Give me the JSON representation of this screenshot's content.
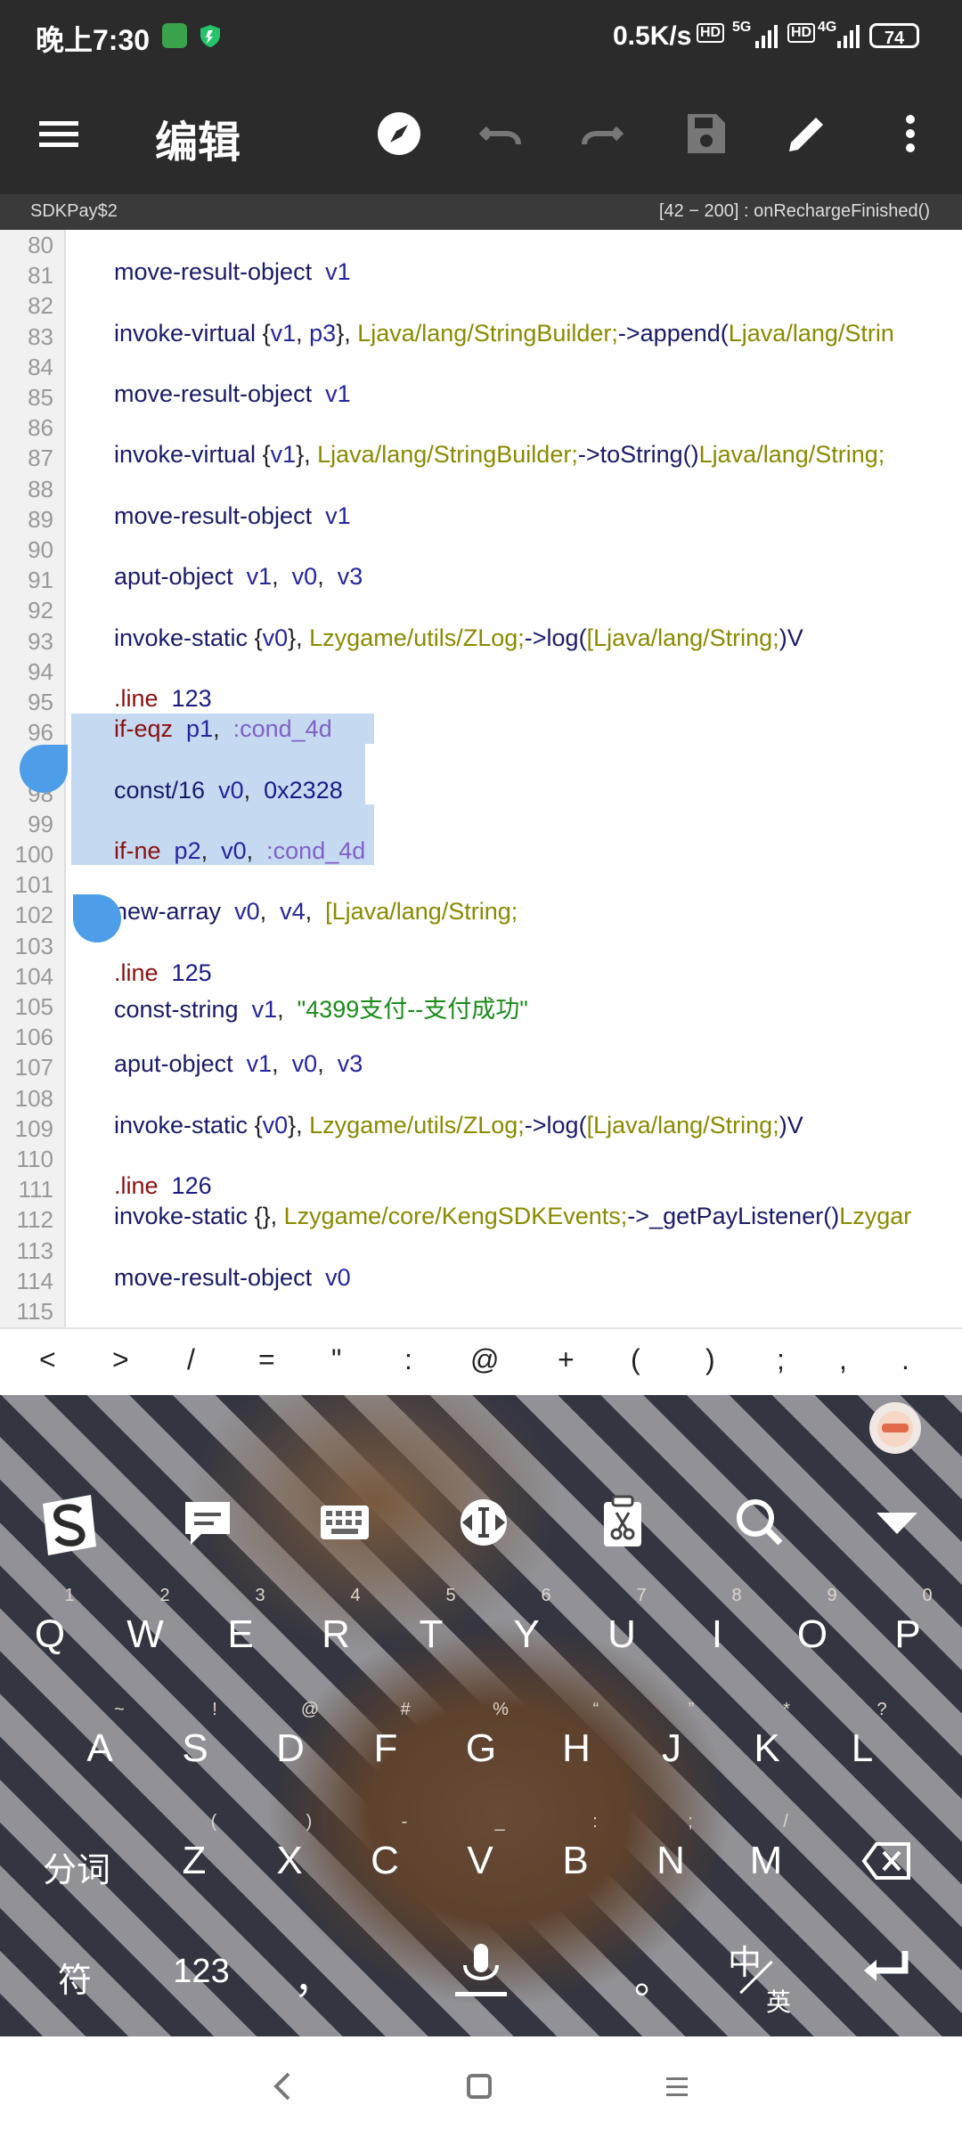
{
  "status_bar": {
    "time": "晚上7:30",
    "speed": "0.5K/s",
    "net1": "5G",
    "net2": "4G",
    "battery": "74"
  },
  "toolbar": {
    "title": "编辑",
    "icons": [
      "menu-icon",
      "compass-icon",
      "undo-icon",
      "redo-icon",
      "save-icon",
      "edit-icon",
      "more-icon"
    ]
  },
  "subbar": {
    "class_name": "SDKPay$2",
    "position": "[42 − 200] : onRechargeFinished()"
  },
  "editor": {
    "line_numbers": [
      "80",
      "81",
      "82",
      "83",
      "84",
      "85",
      "86",
      "87",
      "88",
      "89",
      "90",
      "91",
      "92",
      "93",
      "94",
      "95",
      "96",
      "97",
      "98",
      "99",
      "100",
      "101",
      "102",
      "103",
      "104",
      "105",
      "106",
      "107",
      "108",
      "109",
      "110",
      "111",
      "112",
      "113",
      "114",
      "115"
    ],
    "lines": [
      {
        "n": "81",
        "parts": [
          [
            "kw",
            "move-result-object"
          ],
          [
            "",
            "  "
          ],
          [
            "reg",
            "v1"
          ]
        ]
      },
      {
        "n": "83",
        "parts": [
          [
            "kw",
            "invoke-virtual"
          ],
          [
            "",
            " {"
          ],
          [
            "reg",
            "v1"
          ],
          [
            "",
            ", "
          ],
          [
            "reg",
            "p3"
          ],
          [
            "",
            "}, "
          ],
          [
            "typ",
            "Ljava/lang/StringBuilder;"
          ],
          [
            "kw",
            "->append("
          ],
          [
            "typ",
            "Ljava/lang/Strin"
          ]
        ]
      },
      {
        "n": "85",
        "parts": [
          [
            "kw",
            "move-result-object"
          ],
          [
            "",
            "  "
          ],
          [
            "reg",
            "v1"
          ]
        ]
      },
      {
        "n": "87",
        "parts": [
          [
            "kw",
            "invoke-virtual"
          ],
          [
            "",
            " {"
          ],
          [
            "reg",
            "v1"
          ],
          [
            "",
            "}, "
          ],
          [
            "typ",
            "Ljava/lang/StringBuilder;"
          ],
          [
            "kw",
            "->toString()"
          ],
          [
            "typ",
            "Ljava/lang/String;"
          ]
        ]
      },
      {
        "n": "89",
        "parts": [
          [
            "kw",
            "move-result-object"
          ],
          [
            "",
            "  "
          ],
          [
            "reg",
            "v1"
          ]
        ]
      },
      {
        "n": "91",
        "parts": [
          [
            "kw",
            "aput-object"
          ],
          [
            "",
            "  "
          ],
          [
            "reg",
            "v1"
          ],
          [
            "",
            ",  "
          ],
          [
            "reg",
            "v0"
          ],
          [
            "",
            ",  "
          ],
          [
            "reg",
            "v3"
          ]
        ]
      },
      {
        "n": "93",
        "parts": [
          [
            "kw",
            "invoke-static"
          ],
          [
            "",
            " {"
          ],
          [
            "reg",
            "v0"
          ],
          [
            "",
            "}, "
          ],
          [
            "typ",
            "Lzygame/utils/ZLog;"
          ],
          [
            "kw",
            "->log("
          ],
          [
            "typ",
            "[Ljava/lang/String;"
          ],
          [
            "kw",
            ")V"
          ]
        ]
      },
      {
        "n": "95",
        "parts": [
          [
            "op",
            ".line"
          ],
          [
            "",
            "  "
          ],
          [
            "num",
            "123"
          ]
        ]
      },
      {
        "n": "96",
        "parts": [
          [
            "op",
            "if-eqz"
          ],
          [
            "",
            "  "
          ],
          [
            "reg",
            "p1"
          ],
          [
            "",
            ",  "
          ],
          [
            "lbl",
            ":cond_4d"
          ]
        ]
      },
      {
        "n": "98",
        "parts": [
          [
            "kw",
            "const/16"
          ],
          [
            "",
            "  "
          ],
          [
            "reg",
            "v0"
          ],
          [
            "",
            ",  "
          ],
          [
            "num",
            "0x2328"
          ]
        ]
      },
      {
        "n": "100",
        "parts": [
          [
            "op",
            "if-ne"
          ],
          [
            "",
            "  "
          ],
          [
            "reg",
            "p2"
          ],
          [
            "",
            ",  "
          ],
          [
            "reg",
            "v0"
          ],
          [
            "",
            ",  "
          ],
          [
            "lbl",
            ":cond_4d"
          ]
        ]
      },
      {
        "n": "102",
        "parts": [
          [
            "kw",
            "new-array"
          ],
          [
            "",
            "  "
          ],
          [
            "reg",
            "v0"
          ],
          [
            "",
            ",  "
          ],
          [
            "reg",
            "v4"
          ],
          [
            "",
            ",  "
          ],
          [
            "typ",
            "[Ljava/lang/String;"
          ]
        ]
      },
      {
        "n": "104",
        "parts": [
          [
            "op",
            ".line"
          ],
          [
            "",
            "  "
          ],
          [
            "num",
            "125"
          ]
        ]
      },
      {
        "n": "105",
        "parts": [
          [
            "kw",
            "const-string"
          ],
          [
            "",
            "  "
          ],
          [
            "reg",
            "v1"
          ],
          [
            "",
            ",  "
          ],
          [
            "str",
            "\"4399支付--支付成功\""
          ]
        ]
      },
      {
        "n": "107",
        "parts": [
          [
            "kw",
            "aput-object"
          ],
          [
            "",
            "  "
          ],
          [
            "reg",
            "v1"
          ],
          [
            "",
            ",  "
          ],
          [
            "reg",
            "v0"
          ],
          [
            "",
            ",  "
          ],
          [
            "reg",
            "v3"
          ]
        ]
      },
      {
        "n": "109",
        "parts": [
          [
            "kw",
            "invoke-static"
          ],
          [
            "",
            " {"
          ],
          [
            "reg",
            "v0"
          ],
          [
            "",
            "}, "
          ],
          [
            "typ",
            "Lzygame/utils/ZLog;"
          ],
          [
            "kw",
            "->log("
          ],
          [
            "typ",
            "[Ljava/lang/String;"
          ],
          [
            "kw",
            ")V"
          ]
        ]
      },
      {
        "n": "111",
        "parts": [
          [
            "op",
            ".line"
          ],
          [
            "",
            "  "
          ],
          [
            "num",
            "126"
          ]
        ]
      },
      {
        "n": "112",
        "parts": [
          [
            "kw",
            "invoke-static"
          ],
          [
            "",
            " {}, "
          ],
          [
            "typ",
            "Lzygame/core/KengSDKEvents;"
          ],
          [
            "kw",
            "->_getPayListener()"
          ],
          [
            "typ",
            "Lzygar"
          ]
        ]
      },
      {
        "n": "114",
        "parts": [
          [
            "kw",
            "move-result-object"
          ],
          [
            "",
            "  "
          ],
          [
            "reg",
            "v0"
          ]
        ]
      }
    ]
  },
  "symbols": [
    "<",
    ">",
    "/",
    "=",
    "\"",
    ":",
    "@",
    "+",
    "(",
    ")",
    ";",
    ",",
    "."
  ],
  "keyboard": {
    "toolbar_icons": [
      "sogou-logo-icon",
      "chat-icon",
      "keyboard-icon",
      "cursor-icon",
      "clipboard-icon",
      "search-icon",
      "collapse-icon"
    ],
    "row1": [
      [
        "Q",
        "1"
      ],
      [
        "W",
        "2"
      ],
      [
        "E",
        "3"
      ],
      [
        "R",
        "4"
      ],
      [
        "T",
        "5"
      ],
      [
        "Y",
        "6"
      ],
      [
        "U",
        "7"
      ],
      [
        "I",
        "8"
      ],
      [
        "O",
        "9"
      ],
      [
        "P",
        "0"
      ]
    ],
    "row2": [
      [
        "A",
        "~"
      ],
      [
        "S",
        "!"
      ],
      [
        "D",
        "@"
      ],
      [
        "F",
        "#"
      ],
      [
        "G",
        "%"
      ],
      [
        "H",
        "“"
      ],
      [
        "J",
        "”"
      ],
      [
        "K",
        "*"
      ],
      [
        "L",
        "?"
      ]
    ],
    "row3": [
      [
        "Z",
        "("
      ],
      [
        "X",
        ")"
      ],
      [
        "C",
        "-"
      ],
      [
        "V",
        "_"
      ],
      [
        "B",
        ":"
      ],
      [
        "N",
        ";"
      ],
      [
        "M",
        "/"
      ]
    ],
    "fenci": "分词",
    "fu": "符",
    "num": "123",
    "comma": "，",
    "period": "。",
    "zh": "中",
    "en": "英"
  }
}
